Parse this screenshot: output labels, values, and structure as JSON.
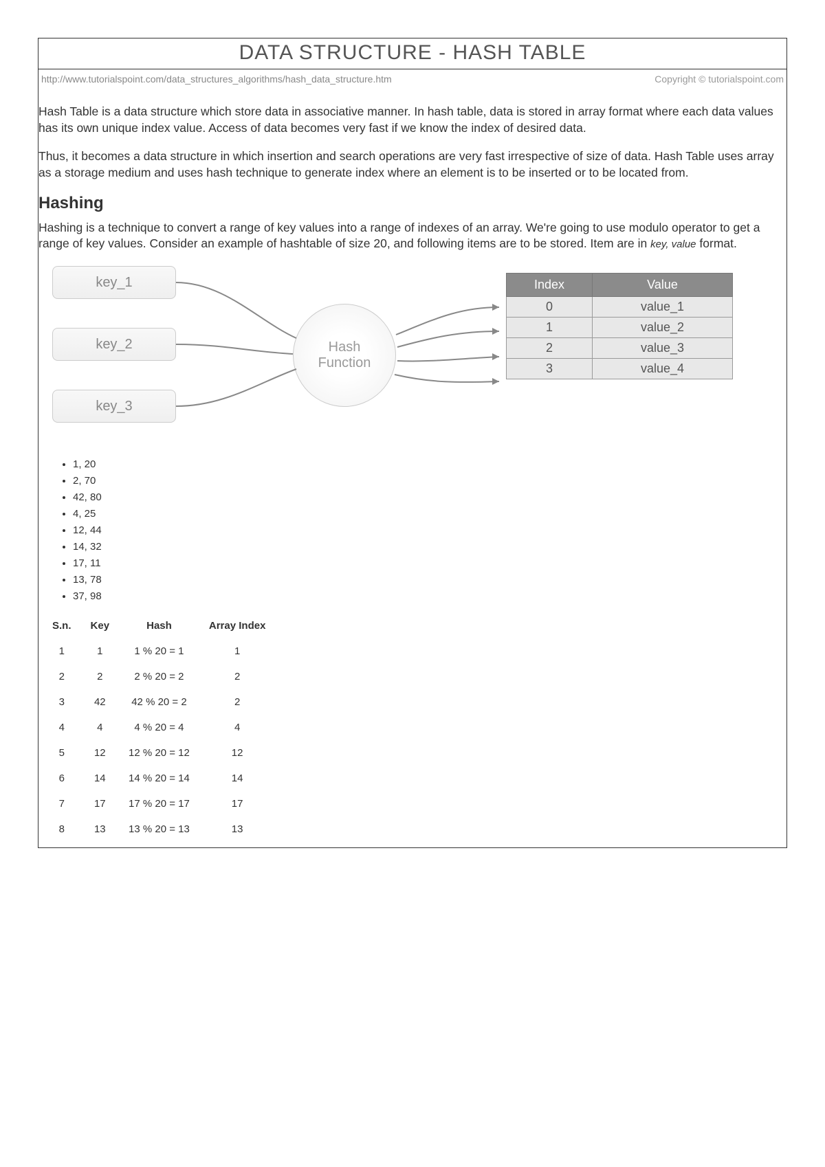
{
  "title": "DATA STRUCTURE - HASH TABLE",
  "meta": {
    "url": "http://www.tutorialspoint.com/data_structures_algorithms/hash_data_structure.htm",
    "copyright": "Copyright © tutorialspoint.com"
  },
  "paragraphs": {
    "p1": "Hash Table is a data structure which store data in associative manner. In hash table, data is stored in array format where each data values has its own unique index value. Access of data becomes very fast if we know the index of desired data.",
    "p2": "Thus, it becomes a data structure in which insertion and search operations are very fast irrespective of size of data. Hash Table uses array as a storage medium and uses hash technique to generate index where an element is to be inserted or to be located from.",
    "hashing_heading": "Hashing",
    "p3_a": "Hashing is a technique to convert a range of key values into a range of indexes of an array. We're going to use modulo operator to get a range of key values. Consider an example of hashtable of size 20, and following items are to be stored. Item are in ",
    "p3_i": "key, value",
    "p3_b": " format."
  },
  "diagram": {
    "keys": [
      "key_1",
      "key_2",
      "key_3"
    ],
    "hash_label_1": "Hash",
    "hash_label_2": "Function",
    "out_headers": [
      "Index",
      "Value"
    ],
    "out_rows": [
      [
        "0",
        "value_1"
      ],
      [
        "1",
        "value_2"
      ],
      [
        "2",
        "value_3"
      ],
      [
        "3",
        "value_4"
      ]
    ]
  },
  "items": [
    "1, 20",
    "2, 70",
    "42, 80",
    "4, 25",
    "12, 44",
    "14, 32",
    "17, 11",
    "13, 78",
    "37, 98"
  ],
  "table": {
    "headers": [
      "S.n.",
      "Key",
      "Hash",
      "Array Index"
    ],
    "rows": [
      [
        "1",
        "1",
        "1 % 20 = 1",
        "1"
      ],
      [
        "2",
        "2",
        "2 % 20 = 2",
        "2"
      ],
      [
        "3",
        "42",
        "42 % 20 = 2",
        "2"
      ],
      [
        "4",
        "4",
        "4 % 20 = 4",
        "4"
      ],
      [
        "5",
        "12",
        "12 % 20 = 12",
        "12"
      ],
      [
        "6",
        "14",
        "14 % 20 = 14",
        "14"
      ],
      [
        "7",
        "17",
        "17 % 20 = 17",
        "17"
      ],
      [
        "8",
        "13",
        "13 % 20 = 13",
        "13"
      ]
    ]
  }
}
